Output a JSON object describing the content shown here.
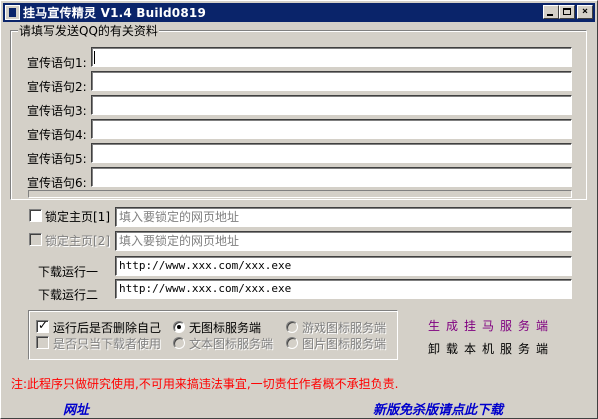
{
  "window": {
    "title": "挂马宣传精灵 V1.4  Build0819",
    "controls": {
      "minimize": "_",
      "maximize": "□",
      "close": "×"
    }
  },
  "group": {
    "legend": "请填写发送QQ的有关资料"
  },
  "slogans": [
    {
      "label": "宣传语句1:",
      "value": ""
    },
    {
      "label": "宣传语句2:",
      "value": ""
    },
    {
      "label": "宣传语句3:",
      "value": ""
    },
    {
      "label": "宣传语句4:",
      "value": ""
    },
    {
      "label": "宣传语句5:",
      "value": ""
    },
    {
      "label": "宣传语句6:",
      "value": ""
    }
  ],
  "homepage": [
    {
      "label": "锁定主页[1]",
      "placeholder": "填入要锁定的网页地址",
      "checked": false,
      "enabled": true
    },
    {
      "label": "锁定主页[2]",
      "placeholder": "填入要锁定的网页地址",
      "checked": false,
      "enabled": false
    }
  ],
  "downloads": [
    {
      "label": "下载运行一",
      "value": "http://www.xxx.com/xxx.exe"
    },
    {
      "label": "下载运行二",
      "value": "http://www.xxx.com/xxx.exe"
    }
  ],
  "options": {
    "delete_self": {
      "label": "运行后是否删除自己",
      "checked": true
    },
    "downloader_only": {
      "label": "是否只当下载者使用",
      "checked": false,
      "enabled": false
    },
    "radios": [
      {
        "label": "无图标服务端",
        "selected": true,
        "enabled": true
      },
      {
        "label": "游戏图标服务端",
        "selected": false,
        "enabled": false
      },
      {
        "label": "文本图标服务端",
        "selected": false,
        "enabled": false
      },
      {
        "label": "图片图标服务端",
        "selected": false,
        "enabled": false
      }
    ]
  },
  "actions": {
    "generate": "生成挂马服务端",
    "uninstall": "卸载本机服务端",
    "generate_color": "#800080"
  },
  "note": "注:此程序只做研究使用,不可用来搞违法事宜,一切责任作者概不承担负责.",
  "footer": {
    "url_link": "网址",
    "download_link": "新版免杀版请点此下载"
  }
}
